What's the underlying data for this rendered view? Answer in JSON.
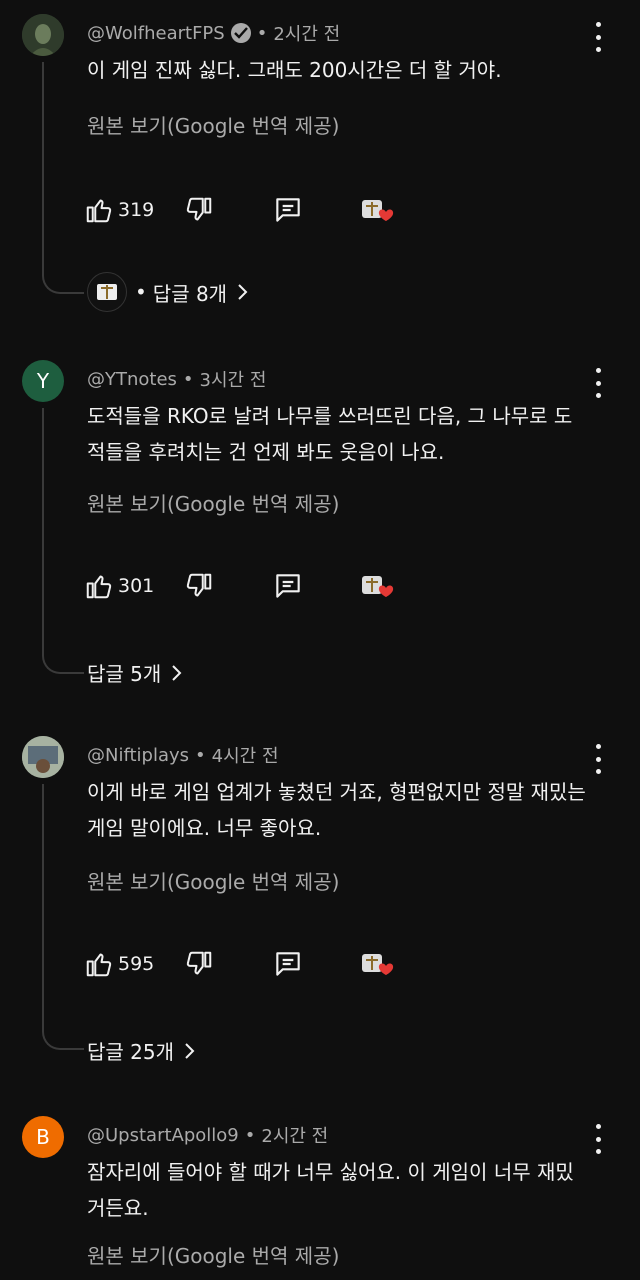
{
  "labels": {
    "translate": "원본 보기(Google 번역 제공)"
  },
  "comments": [
    {
      "handle": "@WolfheartFPS",
      "verified": true,
      "time": "2시간 전",
      "text": "이 게임 진짜 싫다. 그래도 200시간은 더 할 거야.",
      "likes": "319",
      "replies": "답글 8개",
      "replies_prefix": "•",
      "avatar_letter": "",
      "avatar_color": "#3b4a35"
    },
    {
      "handle": "@YTnotes",
      "verified": false,
      "time": "3시간 전",
      "text": "도적들을 RKO로 날려 나무를 쓰러뜨린 다음, 그 나무로 도적들을 후려치는 건 언제 봐도 웃음이 나요.",
      "likes": "301",
      "replies": "답글 5개",
      "avatar_letter": "Y",
      "avatar_color": "#1e5e3f"
    },
    {
      "handle": "@Niftiplays",
      "verified": false,
      "time": "4시간 전",
      "text": "이게 바로 게임 업계가 놓쳤던 거죠, 형편없지만 정말 재밌는 게임 말이에요. 너무 좋아요.",
      "likes": "595",
      "replies": "답글 25개",
      "avatar_letter": "",
      "avatar_color": "#8a9a8a"
    },
    {
      "handle": "@UpstartApollo9",
      "verified": false,
      "time": "2시간 전",
      "text": "잠자리에 들어야 할 때가 너무 싫어요. 이 게임이 너무 재밌거든요.",
      "avatar_letter": "B",
      "avatar_color": "#ef6c00"
    }
  ],
  "colors": {
    "background": "#0f0f0f",
    "text": "#f1f1f1",
    "secondary": "#aaaaaa",
    "heart": "#e53935"
  }
}
